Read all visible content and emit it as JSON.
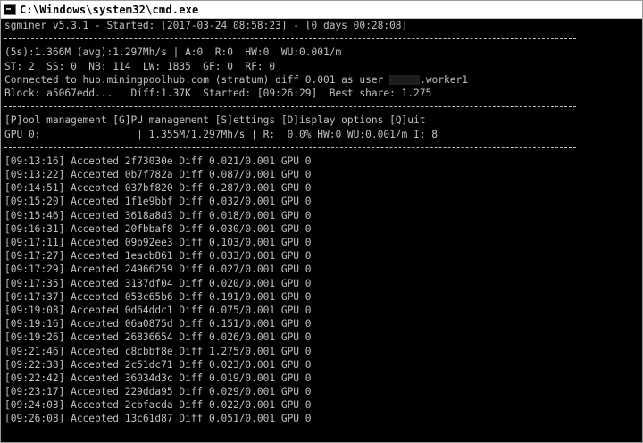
{
  "window": {
    "title": "C:\\Windows\\system32\\cmd.exe"
  },
  "header": {
    "version_line": "sgminer v5.3.1 - Started: [2017-03-24 08:58:23] - [0 days 00:28:08]"
  },
  "stats": {
    "hashrate_line": "(5s):1.366M (avg):1.297Mh/s | A:0  R:0  HW:0  WU:0.001/m",
    "status_line": "ST: 2  SS: 0  NB: 114  LW: 1835  GF: 0  RF: 0",
    "connected_prefix": "Connected to hub.miningpoolhub.com (stratum) diff 0.001 as user ",
    "connected_suffix": ".worker1",
    "block_line": "Block: a5067edd...   Diff:1.37K  Started: [09:26:29]  Best share: 1.275"
  },
  "menu": {
    "options_line": "[P]ool management [G]PU management [S]ettings [D]isplay options [Q]uit",
    "gpu_line": "GPU 0:                | 1.355M/1.297Mh/s | R:  0.0% HW:0 WU:0.001/m I: 8"
  },
  "log": [
    "[09:13:16] Accepted 2f73030e Diff 0.021/0.001 GPU 0",
    "[09:13:22] Accepted 0b7f782a Diff 0.087/0.001 GPU 0",
    "[09:14:51] Accepted 037bf820 Diff 0.287/0.001 GPU 0",
    "[09:15:20] Accepted 1f1e9bbf Diff 0.032/0.001 GPU 0",
    "[09:15:46] Accepted 3618a8d3 Diff 0.018/0.001 GPU 0",
    "[09:16:31] Accepted 20fbbaf8 Diff 0.030/0.001 GPU 0",
    "[09:17:11] Accepted 09b92ee3 Diff 0.103/0.001 GPU 0",
    "[09:17:27] Accepted 1eacb861 Diff 0.033/0.001 GPU 0",
    "[09:17:29] Accepted 24966259 Diff 0.027/0.001 GPU 0",
    "[09:17:35] Accepted 3137df04 Diff 0.020/0.001 GPU 0",
    "[09:17:37] Accepted 053c65b6 Diff 0.191/0.001 GPU 0",
    "[09:19:08] Accepted 0d64ddc1 Diff 0.075/0.001 GPU 0",
    "[09:19:16] Accepted 06a0875d Diff 0.151/0.001 GPU 0",
    "[09:19:26] Accepted 26836654 Diff 0.026/0.001 GPU 0",
    "[09:21:46] Accepted c8cbbf8e Diff 1.275/0.001 GPU 0",
    "[09:22:38] Accepted 2c51dc71 Diff 0.023/0.001 GPU 0",
    "[09:22:42] Accepted 36034d3c Diff 0.019/0.001 GPU 0",
    "[09:23:17] Accepted 229dda95 Diff 0.029/0.001 GPU 0",
    "[09:24:03] Accepted 2cbfacda Diff 0.022/0.001 GPU 0",
    "[09:26:08] Accepted 13c61d87 Diff 0.051/0.001 GPU 0"
  ],
  "colors": {
    "background": "#000000",
    "text": "#c0c0c0",
    "titlebar": "#ffffff"
  },
  "icons": {
    "window_icon": "cmd-icon"
  }
}
